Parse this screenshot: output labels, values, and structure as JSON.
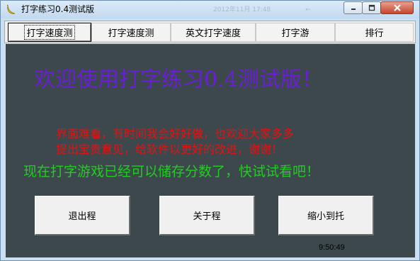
{
  "window": {
    "title": "打字练习0.4测试版",
    "ghost_text_1": "2012年11月 17:48",
    "ghost_text_2": "←"
  },
  "tabs": [
    {
      "label": "打字速度测",
      "active": true
    },
    {
      "label": "打字速度测",
      "active": false
    },
    {
      "label": "英文打字速度",
      "active": false
    },
    {
      "label": "打字游",
      "active": false
    },
    {
      "label": "排行",
      "active": false
    }
  ],
  "main": {
    "welcome": "欢迎使用打字练习0.4测试版！",
    "message_line1": "界面难看，有时间我会好好做，也欢迎大家多多",
    "message_line2": "提出宝贵意见，给软件以更好的改进，谢谢！",
    "message_line3": "现在打字游戏已经可以储存分数了，快试试看吧！"
  },
  "buttons": {
    "exit": "退出程",
    "about": "关于程",
    "minimize_tray": "缩小到托"
  },
  "status": {
    "clock": "9:50:49"
  },
  "colors": {
    "background": "#3c484c",
    "welcome_text": "#6a1ed6",
    "notice_text": "#e01414",
    "info_text": "#22cc22"
  }
}
